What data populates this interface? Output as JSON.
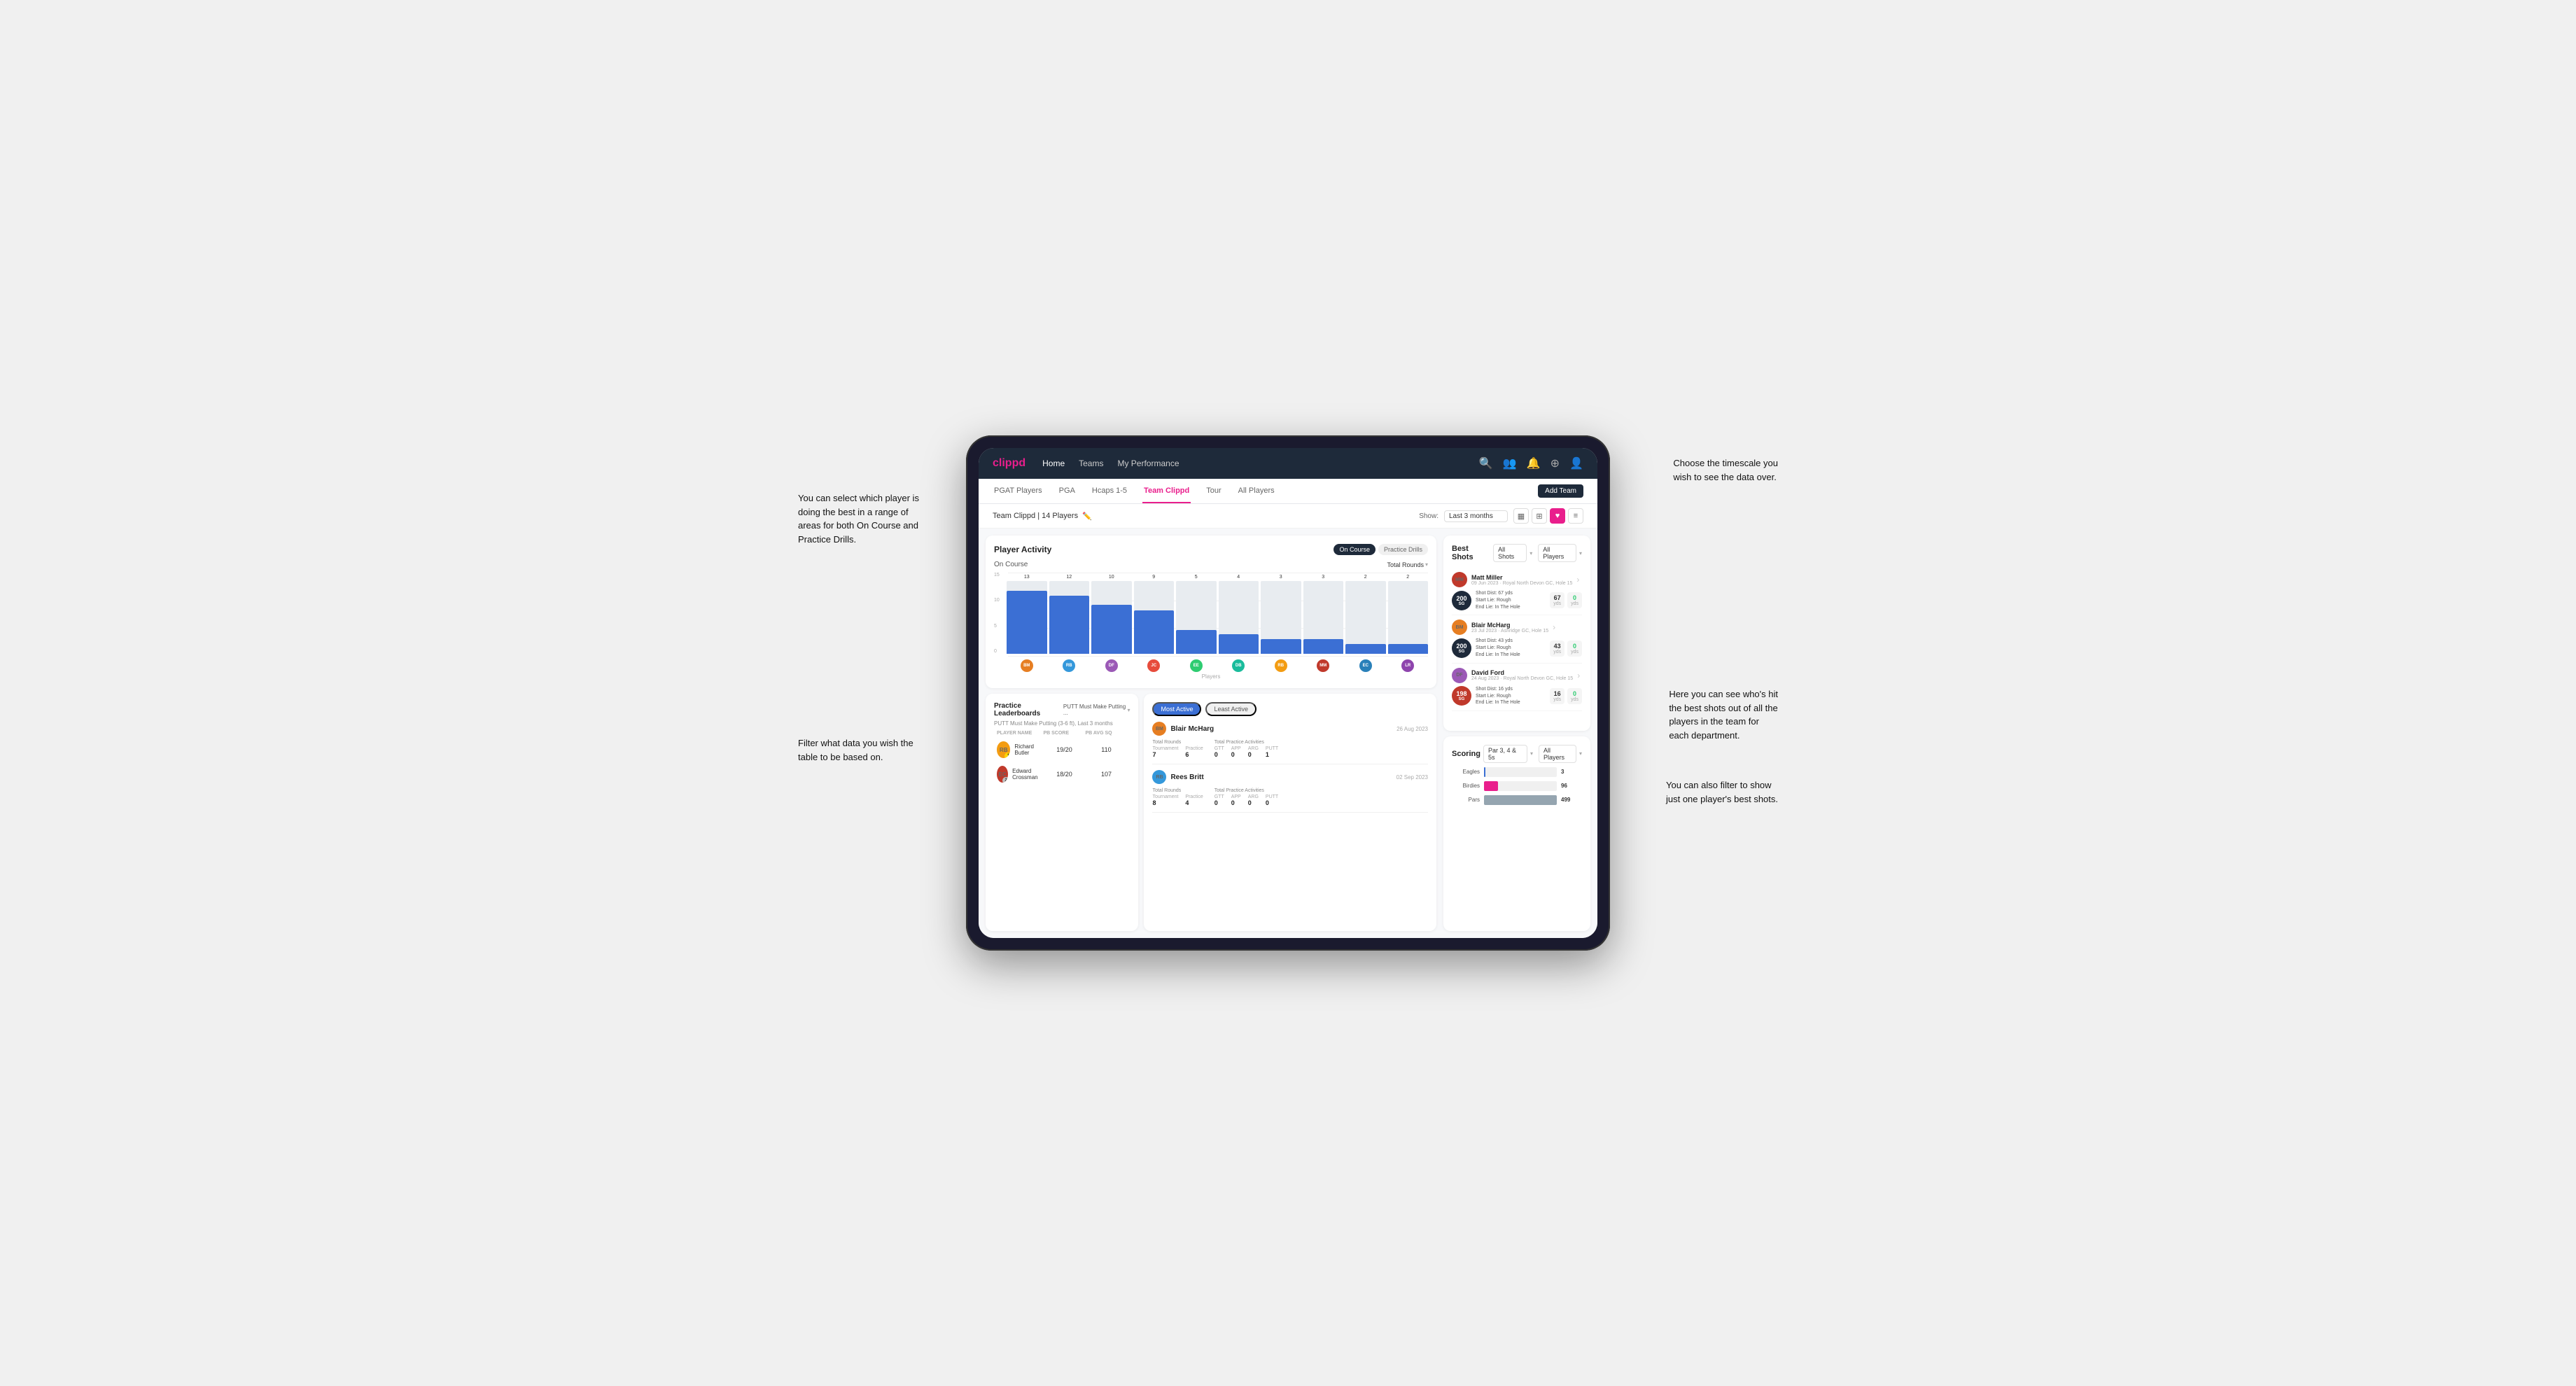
{
  "annotations": {
    "top_left": "You can select which player is\ndoing the best in a range of\nareas for both On Course and\nPractice Drills.",
    "top_right": "Choose the timescale you\nwish to see the data over.",
    "mid_left": "Filter what data you wish the\ntable to be based on.",
    "mid_right": "Here you can see who's hit\nthe best shots out of all the\nplayers in the team for\neach department.",
    "bot_right": "You can also filter to show\njust one player's best shots."
  },
  "nav": {
    "logo": "clippd",
    "links": [
      "Home",
      "Teams",
      "My Performance"
    ],
    "icons": [
      "search",
      "people",
      "bell",
      "add",
      "avatar"
    ]
  },
  "sub_nav": {
    "links": [
      "PGAT Players",
      "PGA",
      "Hcaps 1-5",
      "Team Clippd",
      "Tour",
      "All Players"
    ],
    "active": "Team Clippd",
    "add_btn": "Add Team"
  },
  "team_header": {
    "title": "Team Clippd | 14 Players",
    "show_label": "Show:",
    "show_value": "Last 3 months",
    "view_icons": [
      "grid2",
      "grid3",
      "heart",
      "list"
    ]
  },
  "player_activity": {
    "title": "Player Activity",
    "tabs": [
      "On Course",
      "Practice Drills"
    ],
    "active_tab": "On Course",
    "chart_title": "On Course",
    "chart_dropdown": "Total Rounds",
    "y_labels": [
      "15",
      "10",
      "5",
      "0"
    ],
    "bars": [
      {
        "name": "B. McHarg",
        "value": 13,
        "pct": 87,
        "color": "#3b6fd4"
      },
      {
        "name": "R. Britt",
        "value": 12,
        "pct": 80,
        "color": "#3b6fd4"
      },
      {
        "name": "D. Ford",
        "value": 10,
        "pct": 67,
        "color": "#3b6fd4"
      },
      {
        "name": "J. Coles",
        "value": 9,
        "pct": 60,
        "color": "#3b6fd4"
      },
      {
        "name": "E. Ebert",
        "value": 5,
        "pct": 33,
        "color": "#3b6fd4"
      },
      {
        "name": "D. Billingham",
        "value": 4,
        "pct": 27,
        "color": "#3b6fd4"
      },
      {
        "name": "R. Butler",
        "value": 3,
        "pct": 20,
        "color": "#3b6fd4"
      },
      {
        "name": "M. Miller",
        "value": 3,
        "pct": 20,
        "color": "#3b6fd4"
      },
      {
        "name": "E. Crossman",
        "value": 2,
        "pct": 13,
        "color": "#3b6fd4"
      },
      {
        "name": "L. Robertson",
        "value": 2,
        "pct": 13,
        "color": "#3b6fd4"
      }
    ],
    "x_label": "Players"
  },
  "leaderboard": {
    "title": "Practice Leaderboards",
    "dropdown": "PUTT Must Make Putting ...",
    "subtitle": "PUTT Must Make Putting (3-6 ft), Last 3 months",
    "columns": [
      "Player Name",
      "PB Score",
      "PB Avg SQ"
    ],
    "players": [
      {
        "name": "Richard Butler",
        "rank": 1,
        "pb_score": "19/20",
        "pb_avg": "110"
      },
      {
        "name": "Edward Crossman",
        "rank": 2,
        "pb_score": "18/20",
        "pb_avg": "107"
      }
    ]
  },
  "activity": {
    "tabs": [
      "Most Active",
      "Least Active"
    ],
    "active_tab": "Most Active",
    "players": [
      {
        "name": "Blair McHarg",
        "date": "26 Aug 2023",
        "total_rounds_label": "Total Rounds",
        "tournament": "7",
        "practice": "6",
        "total_practice_label": "Total Practice Activities",
        "gtt": "0",
        "app": "0",
        "arg": "0",
        "putt": "1"
      },
      {
        "name": "Rees Britt",
        "date": "02 Sep 2023",
        "total_rounds_label": "Total Rounds",
        "tournament": "8",
        "practice": "4",
        "total_practice_label": "Total Practice Activities",
        "gtt": "0",
        "app": "0",
        "arg": "0",
        "putt": "0"
      }
    ]
  },
  "best_shots": {
    "title": "Best Shots",
    "filter1": "All Shots",
    "filter2": "All Players",
    "shots": [
      {
        "player": "Matt Miller",
        "date": "09 Jun 2023",
        "course": "Royal North Devon GC",
        "hole": "Hole 15",
        "badge": "200",
        "badge_sub": "SG",
        "dist": "Shot Dist: 67 yds",
        "start": "Start Lie: Rough",
        "end": "End Lie: In The Hole",
        "yds": "67",
        "zero": "0"
      },
      {
        "player": "Blair McHarg",
        "date": "23 Jul 2023",
        "course": "Ashridge GC",
        "hole": "Hole 15",
        "badge": "200",
        "badge_sub": "SG",
        "dist": "Shot Dist: 43 yds",
        "start": "Start Lie: Rough",
        "end": "End Lie: In The Hole",
        "yds": "43",
        "zero": "0"
      },
      {
        "player": "David Ford",
        "date": "24 Aug 2023",
        "course": "Royal North Devon GC",
        "hole": "Hole 15",
        "badge": "198",
        "badge_sub": "SG",
        "dist": "Shot Dist: 16 yds",
        "start": "Start Lie: Rough",
        "end": "End Lie: In The Hole",
        "yds": "16",
        "zero": "0"
      }
    ]
  },
  "scoring": {
    "title": "Scoring",
    "filter1": "Par 3, 4 & 5s",
    "filter2": "All Players",
    "rows": [
      {
        "label": "Eagles",
        "value": 3,
        "pct": 2,
        "color": "eagles"
      },
      {
        "label": "Birdies",
        "value": 96,
        "pct": 19,
        "color": "birdies"
      },
      {
        "label": "Pars",
        "value": 499,
        "pct": 100,
        "color": "pars"
      }
    ]
  }
}
